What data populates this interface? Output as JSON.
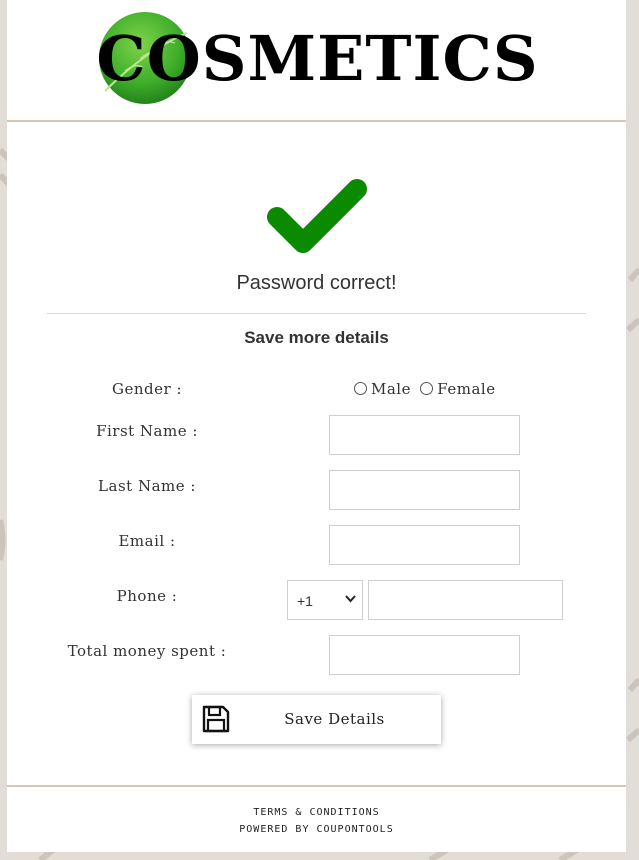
{
  "brand": {
    "logo_text": "COSMETICS",
    "leaf_color": "#3fae2a",
    "rule_color": "#d9c6b2"
  },
  "status": {
    "message": "Password correct!",
    "check_color": "#0b8a00"
  },
  "form": {
    "title": "Save more details",
    "gender_label": "Gender :",
    "gender_options": [
      "Male",
      "Female"
    ],
    "first_name_label": "First Name :",
    "first_name_value": "",
    "last_name_label": "Last Name :",
    "last_name_value": "",
    "email_label": "Email :",
    "email_value": "",
    "phone_label": "Phone :",
    "phone_country_code": "+1",
    "phone_value": "",
    "money_label": "Total money spent :",
    "money_value": "",
    "save_label": "Save Details"
  },
  "footer": {
    "terms": "TERMS & CONDITIONS",
    "powered_by": "POWERED BY COUPONTOOLS"
  }
}
